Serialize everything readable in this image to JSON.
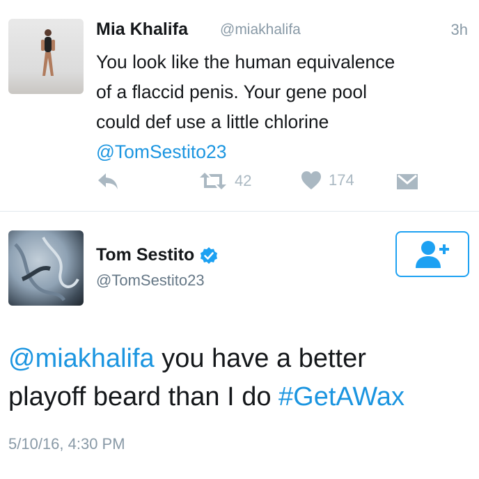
{
  "tweet1": {
    "name": "Mia Khalifa",
    "handle": "@miakhalifa",
    "time": "3h",
    "text_lines": [
      "You look like the human equivalence",
      "of a flaccid penis. Your gene pool",
      "could def use a little chlorine"
    ],
    "mention": "@TomSestito23",
    "retweets": "42",
    "likes": "174",
    "icons": [
      "reply-icon",
      "retweet-icon",
      "heart-icon",
      "dm-icon"
    ]
  },
  "tweet2": {
    "name": "Tom Sestito",
    "handle": "@TomSestito23",
    "mention": "@miakhalifa",
    "text_part1": " you have a better",
    "text_part2": "playoff beard than I do ",
    "hashtag": "#GetAWax",
    "timestamp": "5/10/16, 4:30 PM",
    "icons": [
      "verified-badge-icon",
      "follow-user-icon"
    ]
  },
  "colors": {
    "link": "#1b95e0",
    "muted": "#8899a6",
    "action_gray": "#aab8c2",
    "verified": "#1da1f2"
  }
}
